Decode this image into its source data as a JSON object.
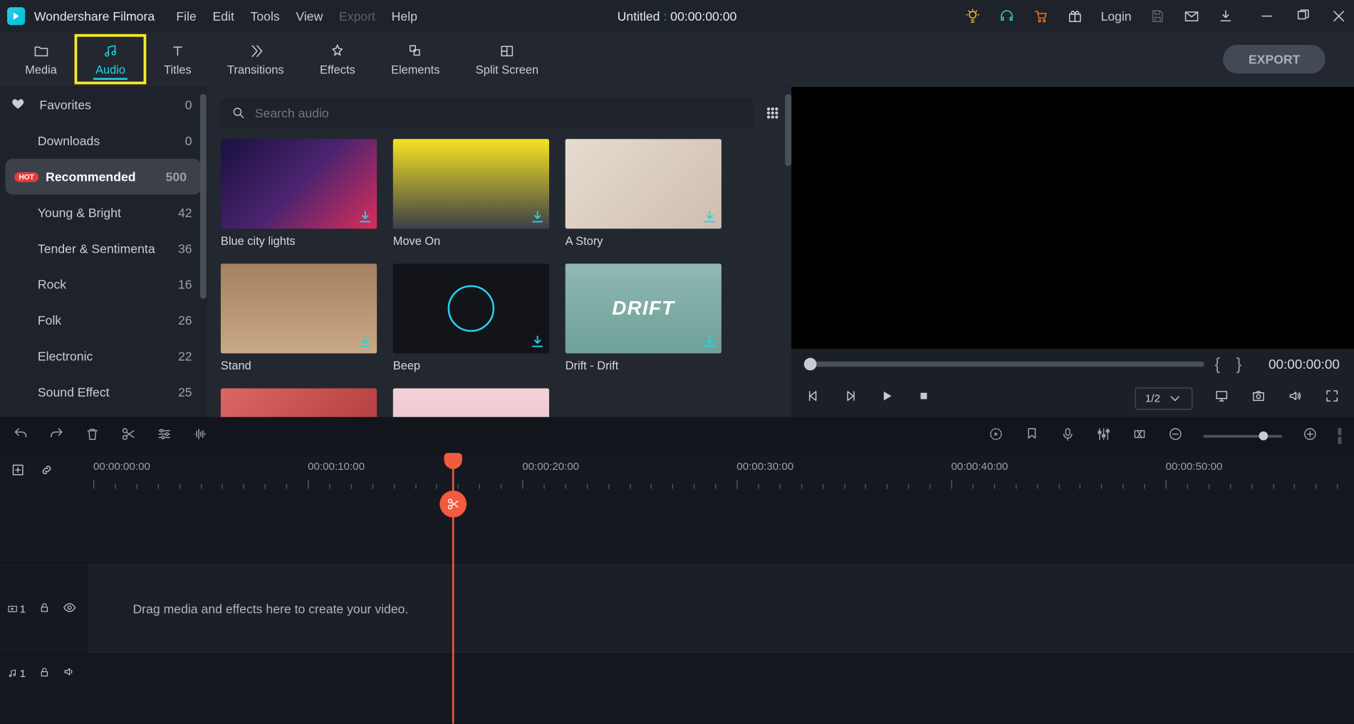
{
  "brand": "Wondershare Filmora",
  "menus": [
    "File",
    "Edit",
    "Tools",
    "View",
    "Export",
    "Help"
  ],
  "project_title_prefix": "Untitled",
  "project_timecode": "00:00:00:00",
  "login_label": "Login",
  "tabs": {
    "media": "Media",
    "audio": "Audio",
    "titles": "Titles",
    "transitions": "Transitions",
    "effects": "Effects",
    "elements": "Elements",
    "split": "Split Screen"
  },
  "export_label": "EXPORT",
  "sidebar": [
    {
      "name": "Favorites",
      "count": "0",
      "fav": true
    },
    {
      "name": "Downloads",
      "count": "0"
    },
    {
      "name": "Recommended",
      "count": "500",
      "selected": true,
      "hot": true
    },
    {
      "name": "Young & Bright",
      "count": "42"
    },
    {
      "name": "Tender & Sentimenta",
      "count": "36"
    },
    {
      "name": "Rock",
      "count": "16"
    },
    {
      "name": "Folk",
      "count": "26"
    },
    {
      "name": "Electronic",
      "count": "22"
    },
    {
      "name": "Sound Effect",
      "count": "25"
    }
  ],
  "search_placeholder": "Search audio",
  "thumbs": [
    {
      "title": "Blue city lights",
      "cls": "t1"
    },
    {
      "title": "Move On",
      "cls": "t2"
    },
    {
      "title": "A Story",
      "cls": "t3"
    },
    {
      "title": "Stand",
      "cls": "t4"
    },
    {
      "title": "Beep",
      "cls": "t5"
    },
    {
      "title": "Drift - Drift",
      "cls": "t6"
    },
    {
      "title": "",
      "cls": "t7"
    },
    {
      "title": "",
      "cls": "t8"
    }
  ],
  "preview": {
    "timecode": "00:00:00:00",
    "zoom_label": "1/2"
  },
  "ruler": [
    "00:00:00:00",
    "00:00:10:00",
    "00:00:20:00",
    "00:00:30:00",
    "00:00:40:00",
    "00:00:50:00"
  ],
  "timeline": {
    "video_track_label": "1",
    "audio_track_label": "1",
    "drop_hint": "Drag media and effects here to create your video."
  },
  "hot_badge_label": "HOT"
}
